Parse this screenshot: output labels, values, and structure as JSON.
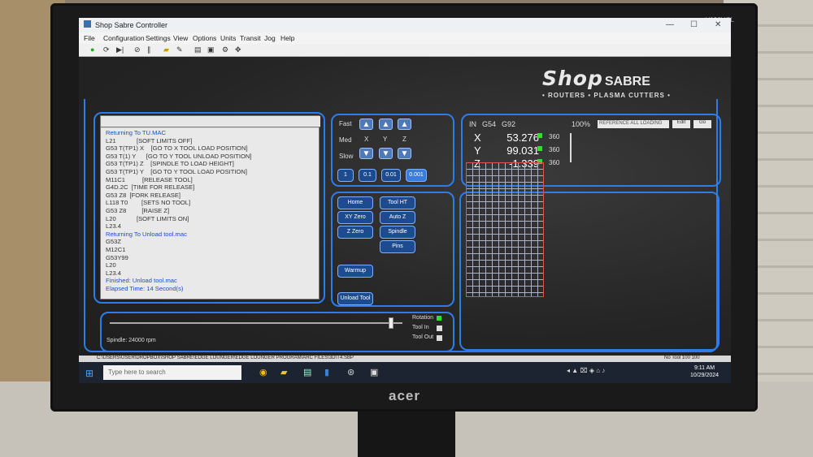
{
  "window": {
    "title": "Shop Sabre Controller"
  },
  "menu": [
    "File",
    "Configuration",
    "Settings",
    "View",
    "Options",
    "Units",
    "Transit",
    "Jog",
    "Help"
  ],
  "toolbar_icons": [
    "play-icon",
    "pause-icon",
    "stop-icon",
    "folder-icon",
    "print-icon",
    "settings-icon"
  ],
  "logo": {
    "shop": "Shop",
    "sabre": "SABRE",
    "tagline": "• ROUTERS • PLASMA CUTTERS •"
  },
  "console": {
    "lines": [
      {
        "text": "Returning To TU.MAC",
        "blue": true
      },
      {
        "text": "L21            [SOFT LIMITS OFF]"
      },
      {
        "text": "G53 T(TP1) X    [GO TO X TOOL LOAD POSITION]"
      },
      {
        "text": "G53 T(1) Y      [GO TO Y TOOL UNLOAD POSITION]"
      },
      {
        "text": "G53 T(TP1) Z    [SPINDLE TO LOAD HEIGHT]"
      },
      {
        "text": "G53 T(TP1) Y    [GO TO Y TOOL LOAD POSITION]"
      },
      {
        "text": "M11C1          [RELEASE TOOL]"
      },
      {
        "text": "G4D.2C  [TIME FOR RELEASE]"
      },
      {
        "text": "G53 Z8  [FORK RELEASE]"
      },
      {
        "text": "L118 T0        [SETS NO TOOL]"
      },
      {
        "text": "G53 Z8         [RAISE Z]"
      },
      {
        "text": "L20            [SOFT LIMITS ON]"
      },
      {
        "text": "L23.4"
      },
      {
        "text": "Returning To Unload tool.mac",
        "blue": true
      },
      {
        "text": "G53Z"
      },
      {
        "text": "M12C1"
      },
      {
        "text": "G53Y99"
      },
      {
        "text": "L20"
      },
      {
        "text": "L23.4"
      },
      {
        "text": "Finished: Unload tool.mac",
        "blue": true
      },
      {
        "text": "Elapsed Time: 14 Second(s)",
        "blue": true
      }
    ]
  },
  "jog": {
    "speed_fast": "Fast",
    "speed_med": "Med",
    "speed_slow": "Slow",
    "axis_x": "X",
    "axis_y": "Y",
    "axis_z": "Z",
    "increments": [
      "1",
      "0.1",
      "0.01",
      "0.001"
    ],
    "selected_increment": "0.001"
  },
  "dro": {
    "units": "IN",
    "work_offset": "G54",
    "g92": "G92",
    "feed_override": "100%",
    "dropdown": "REFERENCE ALL LOADING",
    "edit_label": "Edit",
    "go_label": "Go",
    "axes": [
      {
        "axis": "X",
        "value": "53.276",
        "rate": "360"
      },
      {
        "axis": "Y",
        "value": "99.031",
        "rate": "360"
      },
      {
        "axis": "Z",
        "value": "-1.339",
        "rate": "360"
      }
    ]
  },
  "buttons": {
    "home": "Home",
    "tool_ht": "Tool HT",
    "xy_zero": "XY Zero",
    "auto_z": "Auto Z",
    "z_zero": "Z Zero",
    "spindle": "Spindle",
    "pins": "Pins",
    "warmup": "Warmup",
    "unload_tool": "Unload Tool"
  },
  "spindle": {
    "label": "Spindle: 24000 rpm",
    "level": 0.97,
    "rotation": "Rotation",
    "tool_in": "Tool In",
    "tool_out": "Tool Out"
  },
  "statusbar": {
    "path": "C:\\USERS\\USER\\DROPBOX\\SHOP SABRE\\EDGE LOUNGER\\EDGE LOUNGER PROGRAM\\ARC FILES\\3D\\T4.SBP",
    "right": "No Tool  100  100"
  },
  "taskbar": {
    "search_placeholder": "Type here to search",
    "time": "9:11 AM",
    "date": "10/29/2024"
  }
}
